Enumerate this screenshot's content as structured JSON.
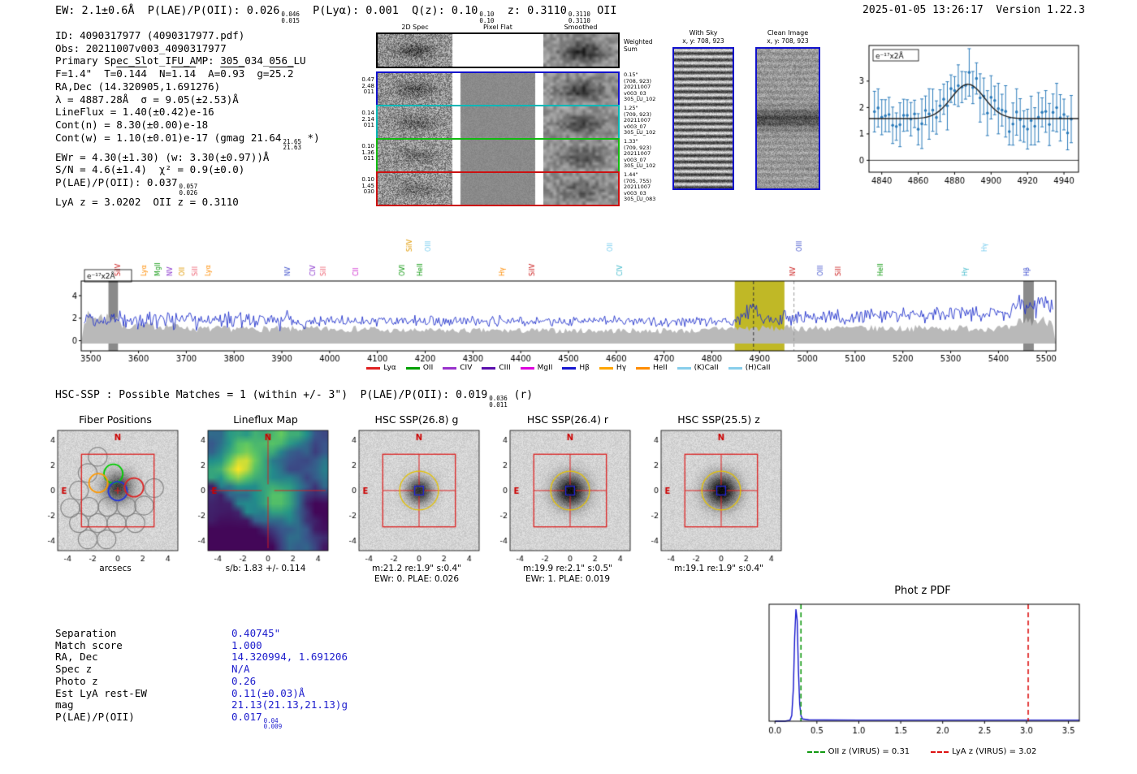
{
  "header": {
    "left_parts": [
      {
        "t": "EW: 2.1±0.6Å  P(LAE)/P(OII): 0.026"
      },
      {
        "hi": "0.046",
        "lo": "0.015"
      },
      {
        "t": "  P(Lyα): 0.001  Q(z): 0.10"
      },
      {
        "hi": "0.10",
        "lo": "0.10"
      },
      {
        "t": "  z: 0.3110"
      },
      {
        "hi": "0.3110",
        "lo": "0.3110"
      },
      {
        "t": " OII"
      }
    ],
    "timestamp": "2025-01-05 13:26:17",
    "version": "Version 1.22.3"
  },
  "info": {
    "lines": [
      {
        "parts": [
          {
            "t": "ID: 4090317977 (4090317977.pdf)"
          }
        ]
      },
      {
        "parts": [
          {
            "t": "Obs: 20211007v003_4090317977"
          }
        ]
      },
      {
        "parts": [
          {
            "t": "Primary Spec_Slot_IFU_AMP: 305_034_056_LU"
          }
        ]
      },
      {
        "parts": [
          {
            "t": "F=1.4\"  T="
          },
          {
            "t": "0.144",
            "ov": true
          },
          {
            "t": "  N="
          },
          {
            "t": "1.14",
            "ov": true
          },
          {
            "t": "  A="
          },
          {
            "t": "0.93",
            "ov": true
          },
          {
            "t": "  g="
          },
          {
            "t": "25.2",
            "ov": true
          }
        ]
      },
      {
        "parts": [
          {
            "t": "RA,Dec (14.320905,1.691276)"
          }
        ]
      },
      {
        "parts": [
          {
            "t": "λ = 4887.28Å  σ = 9.05(±2.53)Å"
          }
        ]
      },
      {
        "parts": [
          {
            "t": "LineFlux = 1.40(±0.42)e-16"
          }
        ]
      },
      {
        "parts": [
          {
            "t": "Cont(n) = 8.30(±0.00)e-18"
          }
        ]
      },
      {
        "parts": [
          {
            "t": "Cont(w) = 1.10(±0.01)e-17 (gmag 21.64"
          },
          {
            "hi": "21.65",
            "lo": "21.63"
          },
          {
            "t": " *)"
          }
        ]
      },
      {
        "parts": [
          {
            "t": "EWr = 4.30(±1.30) (w: 3.30(±0.97))Å"
          }
        ]
      },
      {
        "parts": [
          {
            "t": "S/N = 4.6(±1.4)  χ² = 0.9(±0.0)"
          }
        ]
      },
      {
        "parts": [
          {
            "t": "P(LAE)/P(OII): 0.037"
          },
          {
            "hi": "0.057",
            "lo": "0.026"
          }
        ]
      },
      {
        "parts": [
          {
            "t": "LyA z = 3.0202  OII z = 0.3110"
          }
        ]
      }
    ]
  },
  "spec2d": {
    "col_headers": [
      "2D Spec",
      "Pixel Flat",
      "Smoothed"
    ],
    "weighted": {
      "label_lines": [
        "Weighted",
        "Sum"
      ],
      "border": "#000000"
    },
    "rows": [
      {
        "border": "#1111cc",
        "left": [
          "0.47",
          "2.48",
          "011"
        ],
        "right": [
          "0.15\"",
          "(708, 923)",
          "20211007",
          "v003_03",
          "305_LU_102"
        ]
      },
      {
        "border": "#00b7b7",
        "left": [
          "0.14",
          "2.14",
          "011"
        ],
        "right": [
          "1.25\"",
          "(709, 923)",
          "20211007",
          "v003_07",
          "305_LU_102"
        ]
      },
      {
        "border": "#11bb11",
        "left": [
          "0.10",
          "1.36",
          "011"
        ],
        "right": [
          "1.33\"",
          "(709, 923)",
          "20211007",
          "v003_07",
          "305_LU_102"
        ]
      },
      {
        "border": "#cc1111",
        "left": [
          "0.10",
          "1.45",
          "030"
        ],
        "right": [
          "1.44\"",
          "(705, 755)",
          "20211007",
          "v003_03",
          "305_LU_083"
        ]
      }
    ]
  },
  "stamps": {
    "with_sky": {
      "title": "With Sky",
      "coords": "x, y: 708, 923"
    },
    "clean": {
      "title": "Clean Image",
      "coords": "x, y: 708, 923"
    }
  },
  "hsc_line": {
    "parts": [
      {
        "t": "HSC-SSP : Possible Matches = 1 (within +/- 3\")  P(LAE)/P(OII): 0.019"
      },
      {
        "hi": "0.036",
        "lo": "0.011"
      },
      {
        "t": " (r)"
      }
    ]
  },
  "cutouts": {
    "xticks": [
      -4,
      -2,
      0,
      2,
      4
    ],
    "yticks": [
      4,
      2,
      0,
      -2,
      -4
    ],
    "compass": {
      "north": "N",
      "east": "E"
    },
    "panels": [
      {
        "kind": "fiber",
        "title": "Fiber Positions",
        "caption1": "arcsecs",
        "caption2": ""
      },
      {
        "kind": "lineflux",
        "title": "Lineflux Map",
        "caption1": "s/b: 1.83 +/- 0.114",
        "caption2": ""
      },
      {
        "kind": "img",
        "title": "HSC SSP(26.8) g",
        "caption1": "m:21.2 re:1.9\" s:0.4\"",
        "caption2": "EWr: 0. PLAE: 0.026",
        "blob_amp": 165,
        "blob_sigma": 11
      },
      {
        "kind": "img",
        "title": "HSC SSP(26.4) r",
        "caption1": "m:19.9 re:2.1\" s:0.5\"",
        "caption2": "EWr: 1. PLAE: 0.019",
        "blob_amp": 200,
        "blob_sigma": 14
      },
      {
        "kind": "img",
        "title": "HSC SSP(25.5) z",
        "caption1": "m:19.1 re:1.9\" s:0.4\"",
        "caption2": "",
        "blob_amp": 205,
        "blob_sigma": 14
      }
    ]
  },
  "match": {
    "rows": [
      {
        "label": "Separation",
        "parts": [
          {
            "t": "0.40745\""
          }
        ]
      },
      {
        "label": "Match score",
        "parts": [
          {
            "t": "1.000"
          }
        ]
      },
      {
        "label": "RA, Dec",
        "parts": [
          {
            "t": "14.320994, 1.691206"
          }
        ]
      },
      {
        "label": "Spec z",
        "parts": [
          {
            "t": "N/A"
          }
        ]
      },
      {
        "label": "Photo z",
        "parts": [
          {
            "t": "0.26"
          }
        ]
      },
      {
        "label": "Est LyA rest-EW",
        "parts": [
          {
            "t": "0.11(±0.03)Å"
          }
        ]
      },
      {
        "label": "mag",
        "parts": [
          {
            "t": "21.13(21.13,21.13)g"
          }
        ]
      },
      {
        "label": "P(LAE)/P(OII)",
        "parts": [
          {
            "t": "0.017"
          },
          {
            "hi": "0.04",
            "lo": "0.009"
          }
        ]
      }
    ]
  },
  "chart_data": [
    {
      "id": "line_fit",
      "type": "scatter",
      "ylabel_annotation": "e⁻¹⁷x2Å",
      "xlim": [
        4833,
        4948
      ],
      "ylim": [
        -0.45,
        4.35
      ],
      "xticks": [
        4840,
        4860,
        4880,
        4900,
        4920,
        4940
      ],
      "yticks": [
        0,
        1,
        2,
        3
      ],
      "point_color": "#2b7bba",
      "fit_color": "#222222",
      "fit": {
        "center": 4887.28,
        "sigma": 9.05,
        "amplitude": 1.3,
        "baseline": 1.58
      },
      "x_start": 4836,
      "x_end": 4944,
      "x_step": 2
    },
    {
      "id": "full_spectrum",
      "type": "line",
      "ylabel_annotation": "e⁻¹⁷x2Å",
      "xlim": [
        3480,
        5520
      ],
      "ylim": [
        -0.9,
        5.3
      ],
      "xticks": [
        3500,
        3600,
        3700,
        3800,
        3900,
        4000,
        4100,
        4200,
        4300,
        4400,
        4500,
        4600,
        4700,
        4800,
        4900,
        5000,
        5100,
        5200,
        5300,
        5400,
        5500
      ],
      "yticks": [
        0,
        2,
        4
      ],
      "line_color": "#2233cc",
      "noise_band_color": "#b9b9b9",
      "highlight_band": {
        "x0": 4848,
        "x1": 4952,
        "color": "#b5ab00"
      },
      "dashed_lines": [
        {
          "x": 4887.28,
          "color": "#333333"
        },
        {
          "x": 4972,
          "color": "#999999"
        }
      ],
      "gray_bands": [
        {
          "x0": 3537,
          "x1": 3557
        },
        {
          "x0": 5452,
          "x1": 5474
        }
      ],
      "emission": {
        "center": 4887.28,
        "sigma": 9.05,
        "amplitude": 1.45
      },
      "line_labels": [
        {
          "label": "SiIV",
          "wavelength": 3558,
          "color": "#cc2222",
          "row": 0
        },
        {
          "label": "Lyα",
          "wavelength": 3612,
          "color": "#ff8c00",
          "row": 0
        },
        {
          "label": "MgII",
          "wavelength": 3640,
          "color": "#119911",
          "row": 0
        },
        {
          "label": "NV",
          "wavelength": 3666,
          "color": "#8833cc",
          "row": 0
        },
        {
          "label": "OII",
          "wavelength": 3692,
          "color": "#e09900",
          "row": 0
        },
        {
          "label": "SiII",
          "wavelength": 3718,
          "color": "#ee6677",
          "row": 0
        },
        {
          "label": "Lyα",
          "wavelength": 3746,
          "color": "#ff8c00",
          "row": 0
        },
        {
          "label": "NV",
          "wavelength": 3912,
          "color": "#4455cc",
          "row": 0
        },
        {
          "label": "CIV",
          "wavelength": 3966,
          "color": "#8833cc",
          "row": 0
        },
        {
          "label": "SiII",
          "wavelength": 3988,
          "color": "#ee6677",
          "row": 0
        },
        {
          "label": "CII",
          "wavelength": 4056,
          "color": "#cc22cc",
          "row": 0
        },
        {
          "label": "OVI",
          "wavelength": 4152,
          "color": "#119911",
          "row": 0
        },
        {
          "label": "SiIV",
          "wavelength": 4168,
          "color": "#e09900",
          "row": 1
        },
        {
          "label": "OIII",
          "wavelength": 4206,
          "color": "#77ccee",
          "row": 1
        },
        {
          "label": "HeII",
          "wavelength": 4190,
          "color": "#119911",
          "row": 0
        },
        {
          "label": "Hγ",
          "wavelength": 4362,
          "color": "#ff8c00",
          "row": 0
        },
        {
          "label": "SiIV",
          "wavelength": 4424,
          "color": "#cc2222",
          "row": 0
        },
        {
          "label": "OII",
          "wavelength": 4588,
          "color": "#77ccee",
          "row": 1
        },
        {
          "label": "CIV",
          "wavelength": 4608,
          "color": "#44bbcc",
          "row": 0
        },
        {
          "label": "NV",
          "wavelength": 4970,
          "color": "#cc2222",
          "row": 0
        },
        {
          "label": "OIII",
          "wavelength": 4984,
          "color": "#4455cc",
          "row": 1
        },
        {
          "label": "OIII",
          "wavelength": 5028,
          "color": "#4455cc",
          "row": 0
        },
        {
          "label": "SiII",
          "wavelength": 5066,
          "color": "#cc2222",
          "row": 0
        },
        {
          "label": "HeII",
          "wavelength": 5154,
          "color": "#119911",
          "row": 0
        },
        {
          "label": "Hγ",
          "wavelength": 5330,
          "color": "#44bbcc",
          "row": 0
        },
        {
          "label": "Hγ",
          "wavelength": 5372,
          "color": "#77ccee",
          "row": 1
        },
        {
          "label": "Hβ",
          "wavelength": 5460,
          "color": "#3344cc",
          "row": 0
        }
      ],
      "legend": [
        {
          "label": "Lyα",
          "color": "#e02020"
        },
        {
          "label": "OII",
          "color": "#00a000"
        },
        {
          "label": "CIV",
          "color": "#9932cc"
        },
        {
          "label": "CIII",
          "color": "#5a0dad"
        },
        {
          "label": "MgII",
          "color": "#dd00dd"
        },
        {
          "label": "Hβ",
          "color": "#1515d0"
        },
        {
          "label": "Hγ",
          "color": "#ffa500"
        },
        {
          "label": "HeII",
          "color": "#ff8c00"
        },
        {
          "label": "(K)CaII",
          "color": "#87ceeb"
        },
        {
          "label": "(H)CaII",
          "color": "#87ceeb"
        }
      ]
    },
    {
      "id": "phot_z_pdf",
      "type": "line",
      "title": "Phot z PDF",
      "xlim": [
        -0.07,
        3.63
      ],
      "xticks": [
        0.0,
        0.5,
        1.0,
        1.5,
        2.0,
        2.5,
        3.0,
        3.5
      ],
      "curve_color": "#1515cc",
      "curve": [
        [
          0,
          0
        ],
        [
          0.12,
          0
        ],
        [
          0.18,
          0.01
        ],
        [
          0.2,
          0.05
        ],
        [
          0.22,
          0.3
        ],
        [
          0.235,
          0.75
        ],
        [
          0.25,
          1.0
        ],
        [
          0.265,
          0.9
        ],
        [
          0.28,
          0.45
        ],
        [
          0.295,
          0.15
        ],
        [
          0.31,
          0.05
        ],
        [
          0.33,
          0.02
        ],
        [
          0.4,
          0.013
        ],
        [
          0.6,
          0.011
        ],
        [
          1.0,
          0.01
        ],
        [
          1.5,
          0.01
        ],
        [
          2.0,
          0.01
        ],
        [
          2.5,
          0.01
        ],
        [
          3.0,
          0.01
        ],
        [
          3.63,
          0.01
        ]
      ],
      "vlines": [
        {
          "x": 0.31,
          "color": "#119911",
          "style": "dashed",
          "label": "OII z (VIRUS) = 0.31"
        },
        {
          "x": 3.02,
          "color": "#dd1111",
          "style": "dashed",
          "label": "LyA z (VIRUS) = 3.02"
        }
      ]
    }
  ]
}
